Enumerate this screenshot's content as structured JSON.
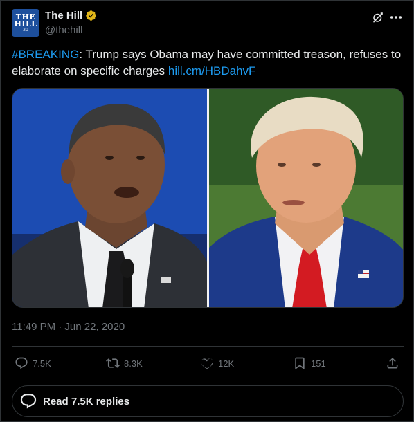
{
  "account": {
    "name": "The Hill",
    "handle": "@thehill",
    "avatar_line1": "THE",
    "avatar_line2": "HILL",
    "avatar_line3": "30"
  },
  "tweet": {
    "hashtag": "#BREAKING",
    "text": ": Trump says Obama may have committed treason, refuses to elaborate on specific charges ",
    "link": "hill.cm/HBDahvF",
    "timestamp": "11:49 PM · Jun 22, 2020"
  },
  "stats": {
    "replies": "7.5K",
    "reposts": "8.3K",
    "likes": "12K",
    "bookmarks": "151"
  },
  "read_replies_label": "Read 7.5K replies",
  "colors": {
    "background": "#000000",
    "text": "#e7e9ea",
    "muted": "#71767b",
    "link": "#1d9bf0",
    "verified": "#e2b719",
    "border": "#2f3336"
  }
}
